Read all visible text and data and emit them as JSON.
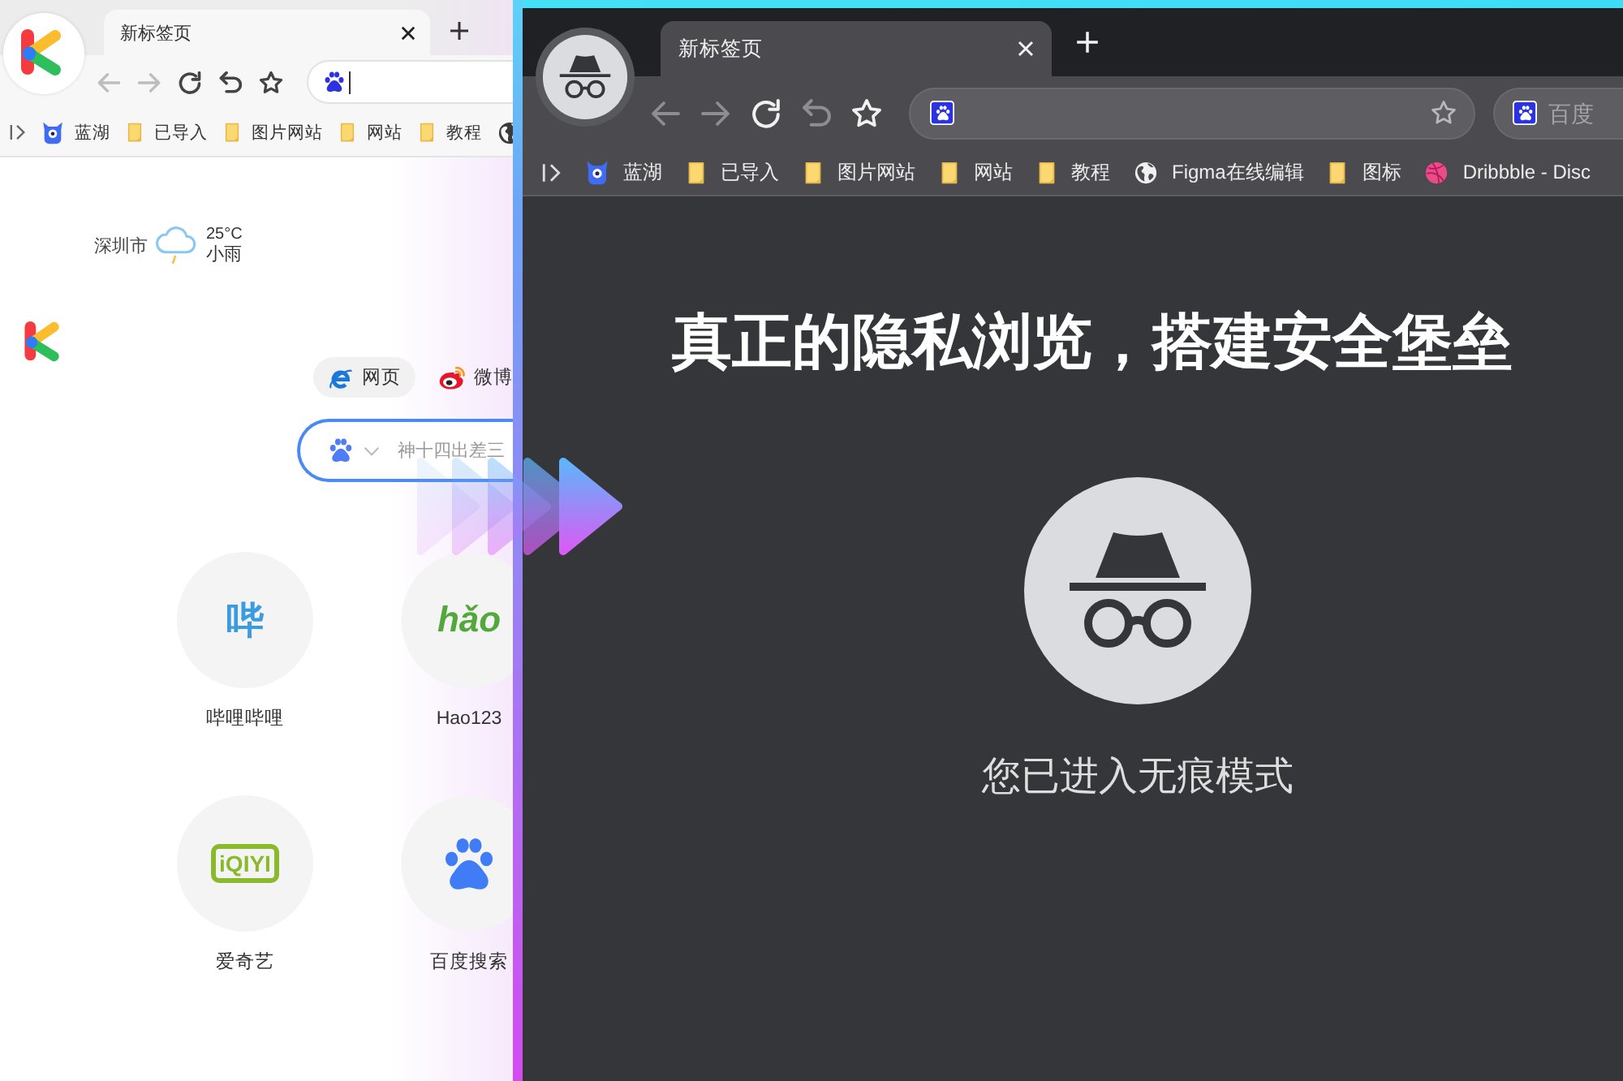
{
  "normal_window": {
    "tab": {
      "title": "新标签页"
    },
    "toolbar": [
      {
        "kind": "back",
        "disabled": true
      },
      {
        "kind": "forward",
        "disabled": true
      },
      {
        "kind": "reload",
        "disabled": false
      },
      {
        "kind": "undo",
        "disabled": false
      },
      {
        "kind": "star",
        "disabled": false
      }
    ],
    "bookmarks": [
      {
        "kind": "site",
        "label": "蓝湖"
      },
      {
        "kind": "folder",
        "label": "已导入"
      },
      {
        "kind": "folder",
        "label": "图片网站"
      },
      {
        "kind": "folder",
        "label": "网站"
      },
      {
        "kind": "folder",
        "label": "教程"
      },
      {
        "kind": "globe"
      }
    ],
    "weather": {
      "city": "深圳市",
      "temperature": "25°C",
      "condition": "小雨"
    },
    "search_tabs": [
      {
        "kind": "web",
        "label": "网页",
        "selected": true
      },
      {
        "kind": "weibo",
        "label": "微博",
        "selected": false
      }
    ],
    "search": {
      "placeholder": "神十四出差三"
    },
    "shortcuts": [
      {
        "kind": "glyph",
        "logo": "哔",
        "label": "哔哩哔哩"
      },
      {
        "kind": "wordmark",
        "logo": "hǎo",
        "label": "Hao123"
      },
      {
        "kind": "framed",
        "logo": "iQIYI",
        "label": "爱奇艺"
      },
      {
        "kind": "paw",
        "label": "百度搜索"
      }
    ]
  },
  "incognito_window": {
    "tab": {
      "title": "新标签页"
    },
    "toolbar": [
      {
        "kind": "back",
        "disabled": true
      },
      {
        "kind": "forward",
        "disabled": true
      },
      {
        "kind": "reload",
        "disabled": false
      },
      {
        "kind": "undo",
        "disabled": true
      },
      {
        "kind": "star",
        "disabled": false
      }
    ],
    "search_box": {
      "placeholder": "百度"
    },
    "bookmarks": [
      {
        "kind": "site",
        "label": "蓝湖"
      },
      {
        "kind": "folder",
        "label": "已导入"
      },
      {
        "kind": "folder",
        "label": "图片网站"
      },
      {
        "kind": "folder",
        "label": "网站"
      },
      {
        "kind": "folder",
        "label": "教程"
      },
      {
        "kind": "globe",
        "label": "Figma在线编辑"
      },
      {
        "kind": "folder",
        "label": "图标"
      },
      {
        "kind": "ball",
        "label": "Dribbble - Disc"
      }
    ],
    "headline": "真正的隐私浏览，搭建安全堡垒",
    "message": "您已进入无痕模式"
  }
}
